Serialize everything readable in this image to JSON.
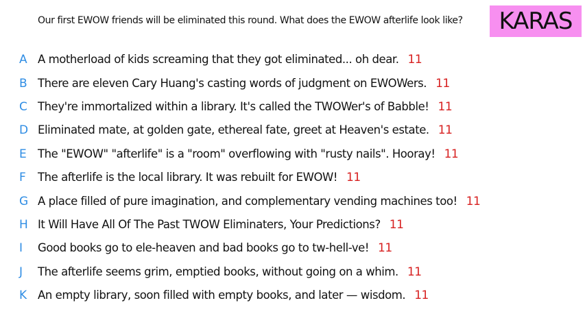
{
  "prompt": "Our first EWOW friends will be eliminated this round. What does the EWOW afterlife look like?",
  "badge": "KARAS",
  "colors": {
    "badge_bg": "#f78ff0",
    "letter": "#2f8de4",
    "score": "#d72020"
  },
  "responses": [
    {
      "letter": "A",
      "text": "A motherload of kids screaming that they got eliminated... oh dear.",
      "score": "11"
    },
    {
      "letter": "B",
      "text": "There are eleven Cary Huang's casting words of judgment on EWOWers.",
      "score": "11"
    },
    {
      "letter": "C",
      "text": "They're immortalized within a library.  It's called the TWOWer's of Babble!",
      "score": "11"
    },
    {
      "letter": "D",
      "text": "Eliminated mate, at golden gate, ethereal fate, greet at Heaven's estate.",
      "score": "11"
    },
    {
      "letter": "E",
      "text": "The \"EWOW\" \"afterlife\" is a \"room\" overflowing with \"rusty nails\". Hooray!",
      "score": "11"
    },
    {
      "letter": "F",
      "text": "The afterlife is the local library. It was rebuilt for EWOW!",
      "score": "11"
    },
    {
      "letter": "G",
      "text": "A place filled of pure imagination, and complementary vending machines too!",
      "score": "11"
    },
    {
      "letter": "H",
      "text": "It Will Have All Of The Past TWOW Eliminaters, Your Predictions?",
      "score": "11"
    },
    {
      "letter": "I",
      "text": "Good books go to ele-heaven and bad books go to tw-hell-ve!",
      "score": "11"
    },
    {
      "letter": "J",
      "text": "The afterlife seems grim, emptied books, without going on a whim.",
      "score": "11"
    },
    {
      "letter": "K",
      "text": "An empty library, soon filled with empty books, and later — wisdom.",
      "score": "11"
    }
  ]
}
